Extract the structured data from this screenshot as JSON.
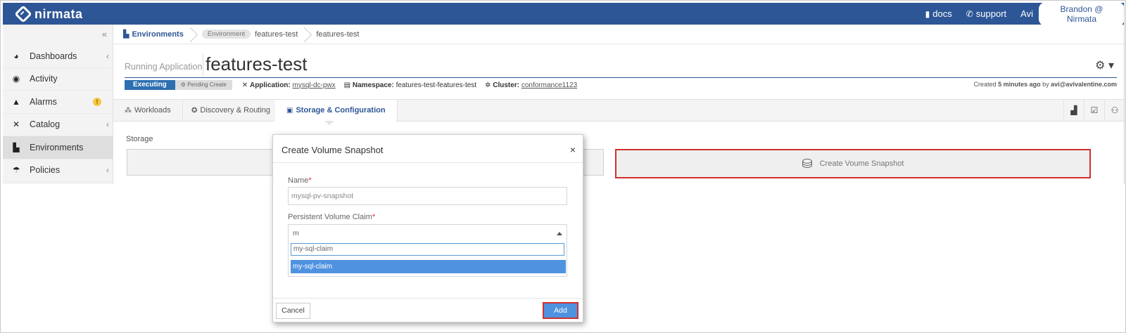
{
  "topbar": {
    "brand": "nirmata",
    "docs_label": "docs",
    "support_label": "support",
    "user_short": "Avi",
    "user_full": "Brandon @ Nirmata"
  },
  "sidebar": {
    "items": [
      {
        "label": "Dashboards",
        "icon": "dashboard-icon"
      },
      {
        "label": "Activity",
        "icon": "activity-icon"
      },
      {
        "label": "Alarms",
        "icon": "bell-icon",
        "badge": "!"
      },
      {
        "label": "Catalog",
        "icon": "tools-icon"
      },
      {
        "label": "Environments",
        "icon": "environments-icon"
      },
      {
        "label": "Policies",
        "icon": "umbrella-icon"
      }
    ]
  },
  "breadcrumb": {
    "root": "Environments",
    "chip": "Environment",
    "env": "features-test",
    "current": "features-test"
  },
  "header": {
    "subtitle": "Running Application",
    "title": "features-test"
  },
  "meta": {
    "status": "Executing",
    "pending": "Pending Create",
    "application_label": "Application:",
    "application_value": "mysql-dc-pwx",
    "namespace_label": "Namespace:",
    "namespace_value": "features-test-features-test",
    "cluster_label": "Cluster:",
    "cluster_value": "conformance1123",
    "created_prefix": "Created",
    "created_time": "5 minutes ago",
    "created_by_word": "by",
    "created_by": "avi@avivalentine.com"
  },
  "tabs": [
    {
      "label": "Workloads"
    },
    {
      "label": "Discovery & Routing"
    },
    {
      "label": "Storage & Configuration"
    }
  ],
  "content": {
    "storage_label": "Storage",
    "create_snapshot_label": "Create Voume Snapshot"
  },
  "modal": {
    "title": "Create Volume Snapshot",
    "close": "×",
    "name_label": "Name",
    "name_value": "mysql-pv-snapshot",
    "pvc_label": "Persistent Volume Claim",
    "pvc_selected": "m",
    "pvc_search": "my-sql-claim",
    "pvc_option": "my-sql-claim",
    "required_mark": "*",
    "cancel_label": "Cancel",
    "add_label": "Add"
  },
  "colors": {
    "brand": "#2d5696",
    "highlight": "#d32f2f",
    "accent": "#4f93e0"
  }
}
